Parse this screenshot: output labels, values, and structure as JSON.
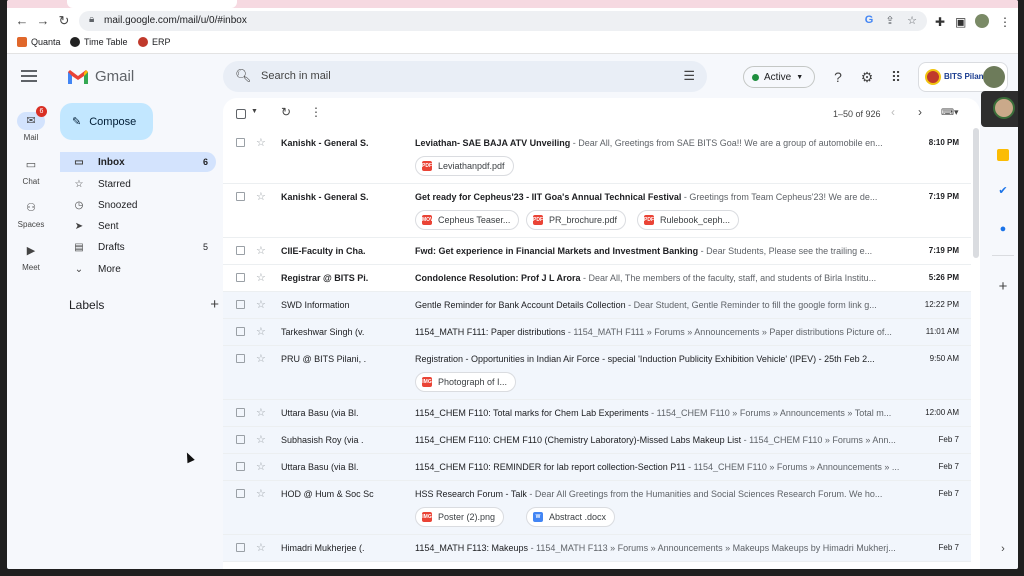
{
  "browser": {
    "url": "mail.google.com/mail/u/0/#inbox",
    "bookmarks": [
      {
        "label": "Quanta",
        "color": "#e0672b"
      },
      {
        "label": "Time Table",
        "color": "#222222"
      },
      {
        "label": "ERP",
        "color": "#c0392b"
      }
    ]
  },
  "gmail": {
    "brand": "Gmail",
    "search_placeholder": "Search in mail",
    "status": "Active",
    "org_badge": "BITS Pilani",
    "rail": [
      {
        "label": "Mail",
        "icon": "mail-icon",
        "badge": "6"
      },
      {
        "label": "Chat",
        "icon": "chat-icon"
      },
      {
        "label": "Spaces",
        "icon": "spaces-icon"
      },
      {
        "label": "Meet",
        "icon": "meet-icon"
      }
    ],
    "compose_label": "Compose",
    "nav": [
      {
        "label": "Inbox",
        "icon": "inbox-icon",
        "count": "6"
      },
      {
        "label": "Starred",
        "icon": "star-icon",
        "count": ""
      },
      {
        "label": "Snoozed",
        "icon": "clock-icon",
        "count": ""
      },
      {
        "label": "Sent",
        "icon": "send-icon",
        "count": ""
      },
      {
        "label": "Drafts",
        "icon": "draft-icon",
        "count": "5"
      },
      {
        "label": "More",
        "icon": "chevron-down-icon",
        "count": ""
      }
    ],
    "labels_heading": "Labels",
    "pagination": "1–50 of 926"
  },
  "emails": [
    {
      "sender": "Kanishk - General S.",
      "subject": "Leviathan- SAE BAJA ATV Unveiling",
      "snippet": " - Dear All, Greetings from SAE BITS Goa!! We are a group of automobile en...",
      "date": "8:10 PM",
      "unread": true,
      "chips": [
        {
          "name": "Leviathanpdf.pdf",
          "type": "PDF",
          "color": "#ea4335"
        }
      ]
    },
    {
      "sender": "Kanishk - General S.",
      "subject": "Get ready for Cepheus'23 - IIT Goa's Annual Technical Festival",
      "snippet": " - Greetings from Team Cepheus'23! We are de...",
      "date": "7:19 PM",
      "unread": true,
      "chips": [
        {
          "name": "Cepheus Teaser...",
          "type": "MOV",
          "color": "#ea4335"
        },
        {
          "name": "PR_brochure.pdf",
          "type": "PDF",
          "color": "#ea4335"
        },
        {
          "name": "Rulebook_ceph...",
          "type": "PDF",
          "color": "#ea4335"
        }
      ]
    },
    {
      "sender": "CIIE-Faculty in Cha.",
      "subject": "Fwd: Get experience in Financial Markets and Investment Banking",
      "snippet": " - Dear Students, Please see the trailing e...",
      "date": "7:19 PM",
      "unread": true,
      "chips": []
    },
    {
      "sender": "Registrar @ BITS Pi.",
      "subject": "Condolence Resolution: Prof J L Arora",
      "snippet": " - Dear All, The members of the faculty, staff, and students of Birla Institu...",
      "date": "5:26 PM",
      "unread": true,
      "chips": []
    },
    {
      "sender": "SWD Information",
      "subject": "Gentle Reminder for Bank Account Details Collection",
      "snippet": " - Dear Student, Gentle Reminder to fill the google form link g...",
      "date": "12:22 PM",
      "unread": false,
      "chips": []
    },
    {
      "sender": "Tarkeshwar Singh (v.",
      "subject": "1154_MATH F111: Paper distributions",
      "snippet": " - 1154_MATH F111 » Forums » Announcements » Paper distributions Picture of...",
      "date": "11:01 AM",
      "unread": false,
      "chips": []
    },
    {
      "sender": "PRU @ BITS Pilani, .",
      "subject": "Registration - Opportunities in Indian Air Force - special 'Induction Publicity Exhibition Vehicle' (IPEV) - 25th Feb 2...",
      "snippet": "",
      "date": "9:50 AM",
      "unread": false,
      "chips": [
        {
          "name": "Photograph of I...",
          "type": "IMG",
          "color": "#ea4335"
        }
      ]
    },
    {
      "sender": "Uttara Basu (via Bl.",
      "subject": "1154_CHEM F110: Total marks for Chem Lab Experiments",
      "snippet": " - 1154_CHEM F110 » Forums » Announcements » Total m...",
      "date": "12:00 AM",
      "unread": false,
      "chips": []
    },
    {
      "sender": "Subhasish Roy (via .",
      "subject": "1154_CHEM F110: CHEM F110 (Chemistry Laboratory)-Missed Labs Makeup List",
      "snippet": " - 1154_CHEM F110 » Forums » Ann...",
      "date": "Feb 7",
      "unread": false,
      "chips": []
    },
    {
      "sender": "Uttara Basu (via Bl.",
      "subject": "1154_CHEM F110: REMINDER for lab report collection-Section P11",
      "snippet": " - 1154_CHEM F110 » Forums » Announcements » ...",
      "date": "Feb 7",
      "unread": false,
      "chips": []
    },
    {
      "sender": "HOD @ Hum & Soc Sc",
      "subject": "HSS Research Forum - Talk",
      "snippet": " - Dear All Greetings from the Humanities and Social Sciences Research Forum. We ho...",
      "date": "Feb 7",
      "unread": false,
      "chips": [
        {
          "name": "Poster (2).png",
          "type": "IMG",
          "color": "#ea4335"
        },
        {
          "name": "Abstract .docx",
          "type": "W",
          "color": "#4285f4"
        }
      ]
    },
    {
      "sender": "Himadri Mukherjee (.",
      "subject": "1154_MATH F113: Makeups",
      "snippet": " - 1154_MATH F113 » Forums » Announcements » Makeups Makeups by Himadri Mukherj...",
      "date": "Feb 7",
      "unread": false,
      "chips": []
    }
  ]
}
